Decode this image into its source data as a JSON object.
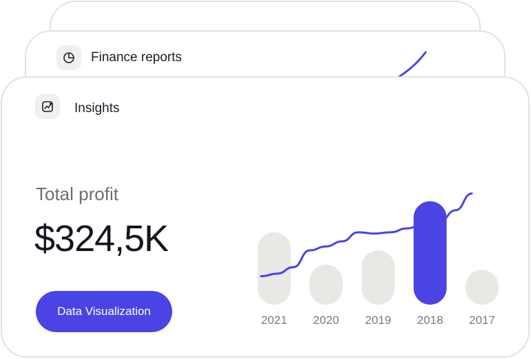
{
  "cards": {
    "back": {},
    "middle": {
      "title": "Finance reports",
      "icon": "pie-chart-icon"
    },
    "front": {
      "title": "Insights",
      "icon": "trend-chart-icon"
    }
  },
  "summary": {
    "label": "Total profit",
    "value": "$324,5K",
    "button_label": "Data Visualization"
  },
  "colors": {
    "accent": "#4a44e4",
    "bar_default": "#eae8e4",
    "border": "#e2e2e0"
  },
  "chart_data": {
    "type": "bar",
    "categories": [
      "2021",
      "2020",
      "2019",
      "2018",
      "2017"
    ],
    "values": [
      56,
      31,
      42,
      80,
      27
    ],
    "highlighted": "2018",
    "ylim": [
      0,
      100
    ],
    "xlabel": "",
    "ylabel": "",
    "title": "",
    "trend_line": [
      22,
      24,
      29,
      42,
      45,
      49,
      56,
      55,
      56,
      59,
      62,
      64,
      73,
      86
    ]
  }
}
